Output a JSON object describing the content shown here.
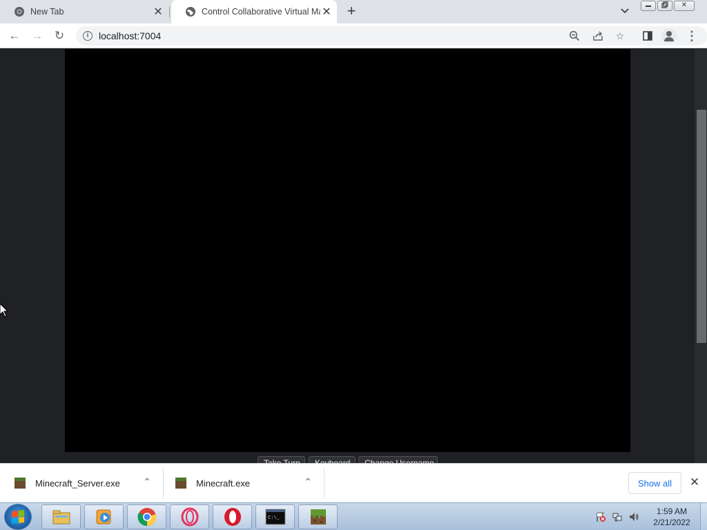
{
  "browser": {
    "tabs": [
      {
        "title": "New Tab",
        "icon": "chrome-icon",
        "active": false
      },
      {
        "title": "Control Collaborative Virtual Machine",
        "icon": "globe-icon",
        "active": true
      }
    ],
    "new_tab_symbol": "+",
    "tab_search_symbol": "⌄",
    "window_controls": {
      "minimize": "▭",
      "restore": "◱",
      "close": "✕"
    },
    "toolbar": {
      "back_icon": "←",
      "forward_icon": "→",
      "reload_icon": "↻",
      "url": "localhost:7004",
      "site_info_icon": "i",
      "zoom_icon": "⊖",
      "share_icon": "⇪",
      "bookmark_icon": "☆",
      "side_panel_icon": "▯",
      "menu_icon": "⋮"
    }
  },
  "page": {
    "vm_buttons": [
      "Take Turn",
      "Keyboard",
      "Change Username"
    ],
    "background_color": "#202124",
    "vm_screen_color": "#000000"
  },
  "downloads": {
    "items": [
      {
        "name": "Minecraft_Server.exe",
        "chevron": "⌃"
      },
      {
        "name": "Minecraft.exe",
        "chevron": "⌃"
      }
    ],
    "show_all_label": "Show all",
    "close_symbol": "✕"
  },
  "taskbar": {
    "pinned": [
      {
        "name": "windows-explorer-icon"
      },
      {
        "name": "media-player-icon"
      },
      {
        "name": "chrome-icon"
      },
      {
        "name": "opera-gx-icon"
      },
      {
        "name": "opera-icon"
      },
      {
        "name": "command-prompt-icon",
        "label": "C:\\_"
      },
      {
        "name": "minecraft-icon"
      }
    ],
    "clock_time": "1:59 AM",
    "clock_date": "2/21/2022"
  }
}
